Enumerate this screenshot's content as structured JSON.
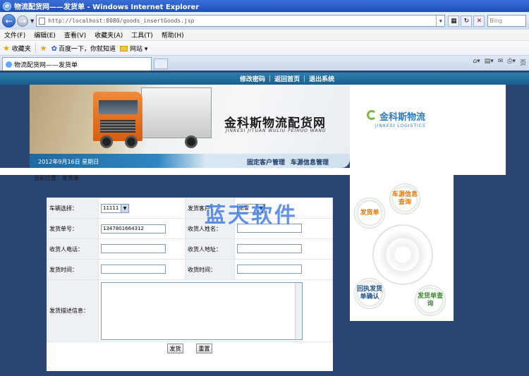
{
  "window": {
    "title": "物流配货网——发货单 - Windows Internet Explorer",
    "logo": "e"
  },
  "address": {
    "url": "http://localhost:8080/goods_insertGoods.jsp",
    "search_placeholder": "Bing"
  },
  "menu": [
    "文件(F)",
    "编辑(E)",
    "查看(V)",
    "收藏夹(A)",
    "工具(T)",
    "帮助(H)"
  ],
  "favorites": {
    "label": "收藏夹",
    "items": [
      "百度一下，你就知道",
      "网站"
    ]
  },
  "tab": {
    "title": "物流配货网——发货单"
  },
  "page": {
    "top_links": [
      "修改密码",
      "返回首页",
      "退出系统"
    ],
    "banner_title": "金科斯物流配货网",
    "banner_subtitle": "JINKESI JITUAN WULIU PEIHUO WANG",
    "date": "2012年9月16日 星期日",
    "manage_links": [
      "固定客户管理",
      "车源信息管理"
    ],
    "brand": {
      "name": "金科斯物流",
      "en": "JINKESI LOGISTICS"
    },
    "location": "当前位置：发货单",
    "side_buttons": [
      "车源信息查询",
      "发货单",
      "回执发货单确认",
      "发货单查询"
    ],
    "watermark": "蓝天软件"
  },
  "form": {
    "vehicle_label": "车辆选择：",
    "vehicle_value": "11111",
    "customer_label": "发货客户：",
    "customer_value": "张雷",
    "order_no_label": "发货单号：",
    "order_no_value": "1347801664312",
    "receiver_name_label": "收货人姓名：",
    "receiver_phone_label": "收货人电话：",
    "receiver_address_label": "收货人地址：",
    "send_time_label": "发货时间：",
    "receive_time_label": "收货时间：",
    "description_label": "发货描述信息：",
    "submit_label": "发货",
    "reset_label": "重置"
  }
}
